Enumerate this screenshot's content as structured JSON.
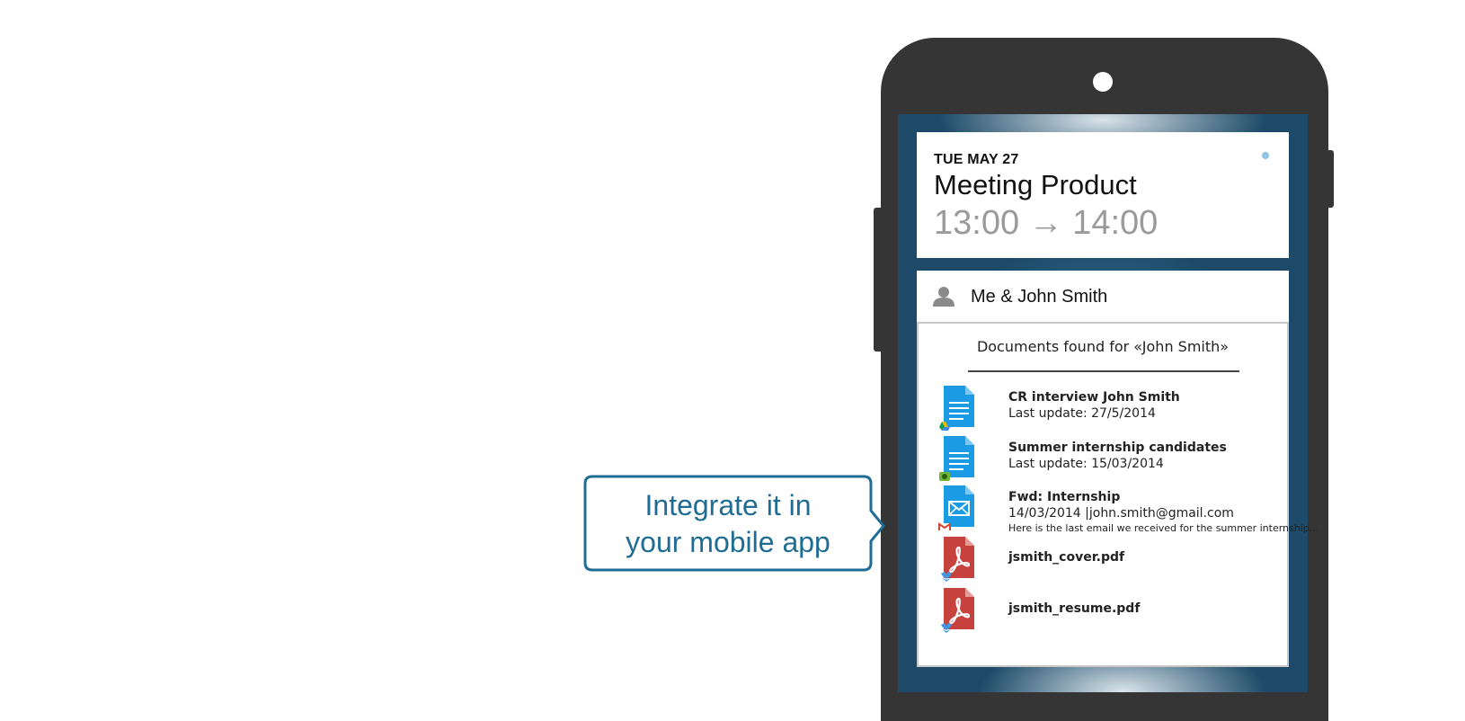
{
  "event": {
    "date": "TUE MAY 27",
    "title": "Meeting Product",
    "time": "13:00 → 14:00"
  },
  "attendees": {
    "label": "Me & John Smith",
    "icon": "person-icon"
  },
  "documents": {
    "title": "Documents found for «John Smith»",
    "items": [
      {
        "name": "CR interview John Smith",
        "meta": "Last update: 27/5/2014",
        "snippet": "",
        "file_icon": "google-doc-icon",
        "source_icon": "google-drive-icon"
      },
      {
        "name": "Summer internship candidates",
        "meta": "Last update: 15/03/2014",
        "snippet": "",
        "file_icon": "google-doc-icon",
        "source_icon": "evernote-icon"
      },
      {
        "name": "Fwd: Internship",
        "meta": "14/03/2014 |john.smith@gmail.com",
        "snippet": "Here is the last email we received for the summer internship...",
        "file_icon": "email-icon",
        "source_icon": "gmail-icon"
      },
      {
        "name": "jsmith_cover.pdf",
        "meta": "",
        "snippet": "",
        "file_icon": "pdf-icon",
        "source_icon": "dropbox-icon"
      },
      {
        "name": "jsmith_resume.pdf",
        "meta": "",
        "snippet": "",
        "file_icon": "pdf-icon",
        "source_icon": "dropbox-icon"
      }
    ]
  },
  "callout": {
    "line1": "Integrate it in",
    "line2": "your mobile app"
  },
  "colors": {
    "callout_border": "#1f6c94",
    "doc_blue": "#1a9be4",
    "pdf_red": "#c7423d",
    "phone_body": "#353535"
  }
}
